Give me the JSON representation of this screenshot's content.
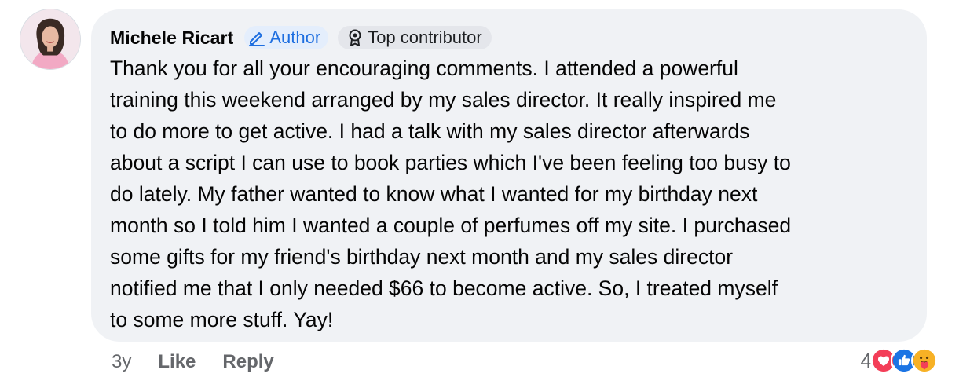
{
  "comment": {
    "author": "Michele Ricart",
    "author_badge": "Author",
    "contributor_badge": "Top contributor",
    "text": "Thank you for all your encouraging comments. I attended a powerful\ntraining this weekend arranged by my sales director. It really inspired me\nto do more to get active. I had a talk with my sales director afterwards\nabout a script I can use to book parties which I've been feeling too busy to\ndo lately. My father wanted to know what I wanted for my birthday next\nmonth so I told him I wanted a couple of perfumes off my site. I purchased\nsome gifts for my friend's birthday next month and my sales director\nnotified me that I only needed $66 to become active. So, I treated myself\nto some more stuff. Yay!"
  },
  "footer": {
    "timestamp": "3y",
    "like_label": "Like",
    "reply_label": "Reply"
  },
  "reactions": {
    "count": "4",
    "icons": [
      "love-icon",
      "like-icon",
      "care-icon"
    ]
  },
  "colors": {
    "bubble": "#f0f2f5",
    "author_badge_text": "#1d6ee0",
    "muted": "#65676b",
    "love": "#f33e58",
    "like": "#1b74e4",
    "care": "#f7b125"
  }
}
